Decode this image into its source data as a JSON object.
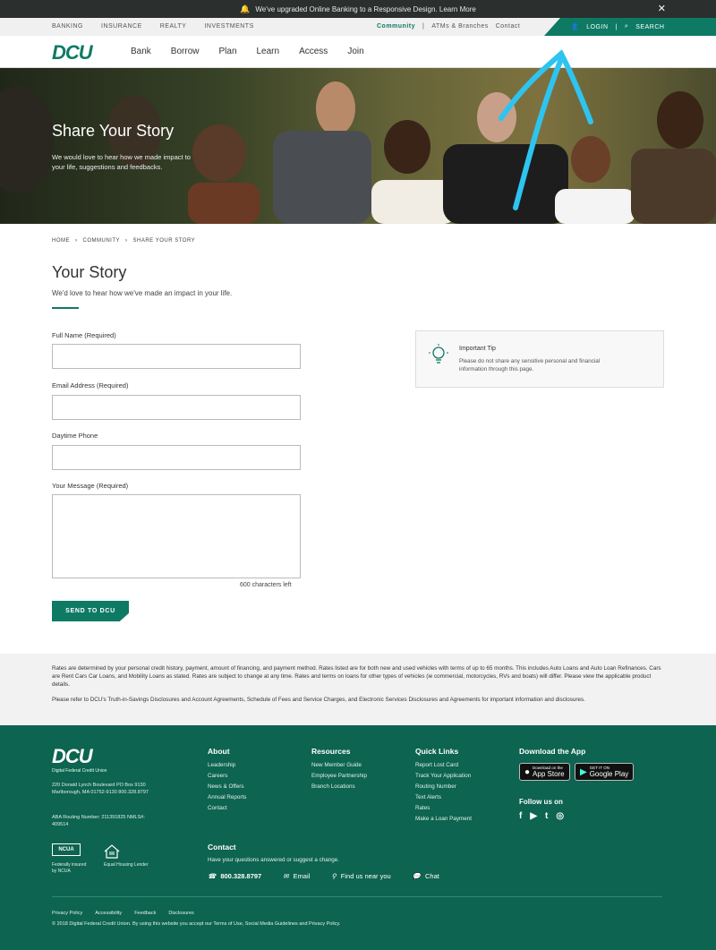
{
  "banner": {
    "text": "We've upgraded Online Banking to a Responsive Design. Learn More",
    "close": "✕"
  },
  "util": {
    "left": [
      "Banking",
      "Insurance",
      "Realty",
      "Investments"
    ],
    "community": "Community",
    "atm": "ATMs & Branches",
    "contact": "Contact",
    "login": "LOGIN",
    "search": "SEARCH"
  },
  "nav": {
    "logo": "DCU",
    "items": [
      "Bank",
      "Borrow",
      "Plan",
      "Learn",
      "Access",
      "Join"
    ]
  },
  "hero": {
    "title": "Share Your Story",
    "subtitle": "We would love to hear how we made impact to your life, suggestions and feedbacks."
  },
  "breadcrumb": {
    "home": "HOME",
    "community": "COMMUNITY",
    "current": "SHARE YOUR STORY"
  },
  "form": {
    "heading": "Your Story",
    "lead": "We'd love to hear how we've made an impact in your life.",
    "full_name": "Full Name (Required)",
    "email": "Email Address (Required)",
    "phone": "Daytime Phone",
    "message": "Your Message (Required)",
    "chars": "600 characters left",
    "send": "SEND TO DCU"
  },
  "tip": {
    "title": "Important Tip",
    "body": "Please do not share any sensitive personal and financial information through this page."
  },
  "disclaimer": {
    "p1": "Rates are determined by your personal credit history, payment, amount of financing, and payment method. Rates listed are for both new and used vehicles with terms of up to 65 months. This includes Auto Loans and Auto Loan Refinances. Cars are Rent Cars Car Loans, and Mobility Loans as stated. Rates are subject to change at any time. Rates and terms on loans for other types of vehicles (ie commercial, motorcycles, RVs and boats) will differ. Please view the applicable product details.",
    "p2": "Please refer to DCU's Truth-in-Savings Disclosures and Account Agreements, Schedule of Fees and Service Charges, and Electronic Services Disclosures and Agreements for important information and disclosures."
  },
  "footer": {
    "logo": "DCU",
    "tagline": "Digital Federal Credit Union",
    "address": "220 Donald Lynch Boulevard PO Box 9130 Marlborough, MA 01752-9130 800.328.8797",
    "routing": "ABA Routing Number: 211391825 NMLS#: 409514",
    "ncua": "NCUA",
    "ncua_text": "Federally insured by NCUA",
    "ehl_text": "Equal Housing Lender",
    "about": {
      "heading": "About",
      "links": [
        "Leadership",
        "Careers",
        "News & Offers",
        "Annual Reports",
        "Contact"
      ]
    },
    "resources": {
      "heading": "Resources",
      "links": [
        "New Member Guide",
        "Employee Partnership",
        "Branch Locations"
      ]
    },
    "quick": {
      "heading": "Quick Links",
      "links": [
        "Report Lost Card",
        "Track Your Application",
        "Routing Number",
        "Text Alerts",
        "Rates",
        "Make a Loan Payment"
      ]
    },
    "download": "Download the App",
    "appstore": {
      "top": "Download on the",
      "main": "App Store"
    },
    "googleplay": {
      "top": "GET IT ON",
      "main": "Google Play"
    },
    "follow": "Follow us on",
    "social": [
      "f",
      "▶",
      "t",
      "◎"
    ],
    "contact": {
      "heading": "Contact",
      "sub": "Have your questions answered or suggest a change.",
      "phone": "800.328.8797",
      "email": "Email",
      "find": "Find us near you",
      "chat": "Chat"
    },
    "bottom_links": [
      "Privacy Policy",
      "Accessibility",
      "Feedback",
      "Disclosures"
    ],
    "copyright": "© 2018 Digital Federal Credit Union. By using this website you accept our Terms of Use, Social Media Guidelines and Privacy Policy."
  },
  "colors": {
    "brand": "#0e7a64",
    "footer": "#0d6450",
    "annotation": "#2ec4f0"
  }
}
